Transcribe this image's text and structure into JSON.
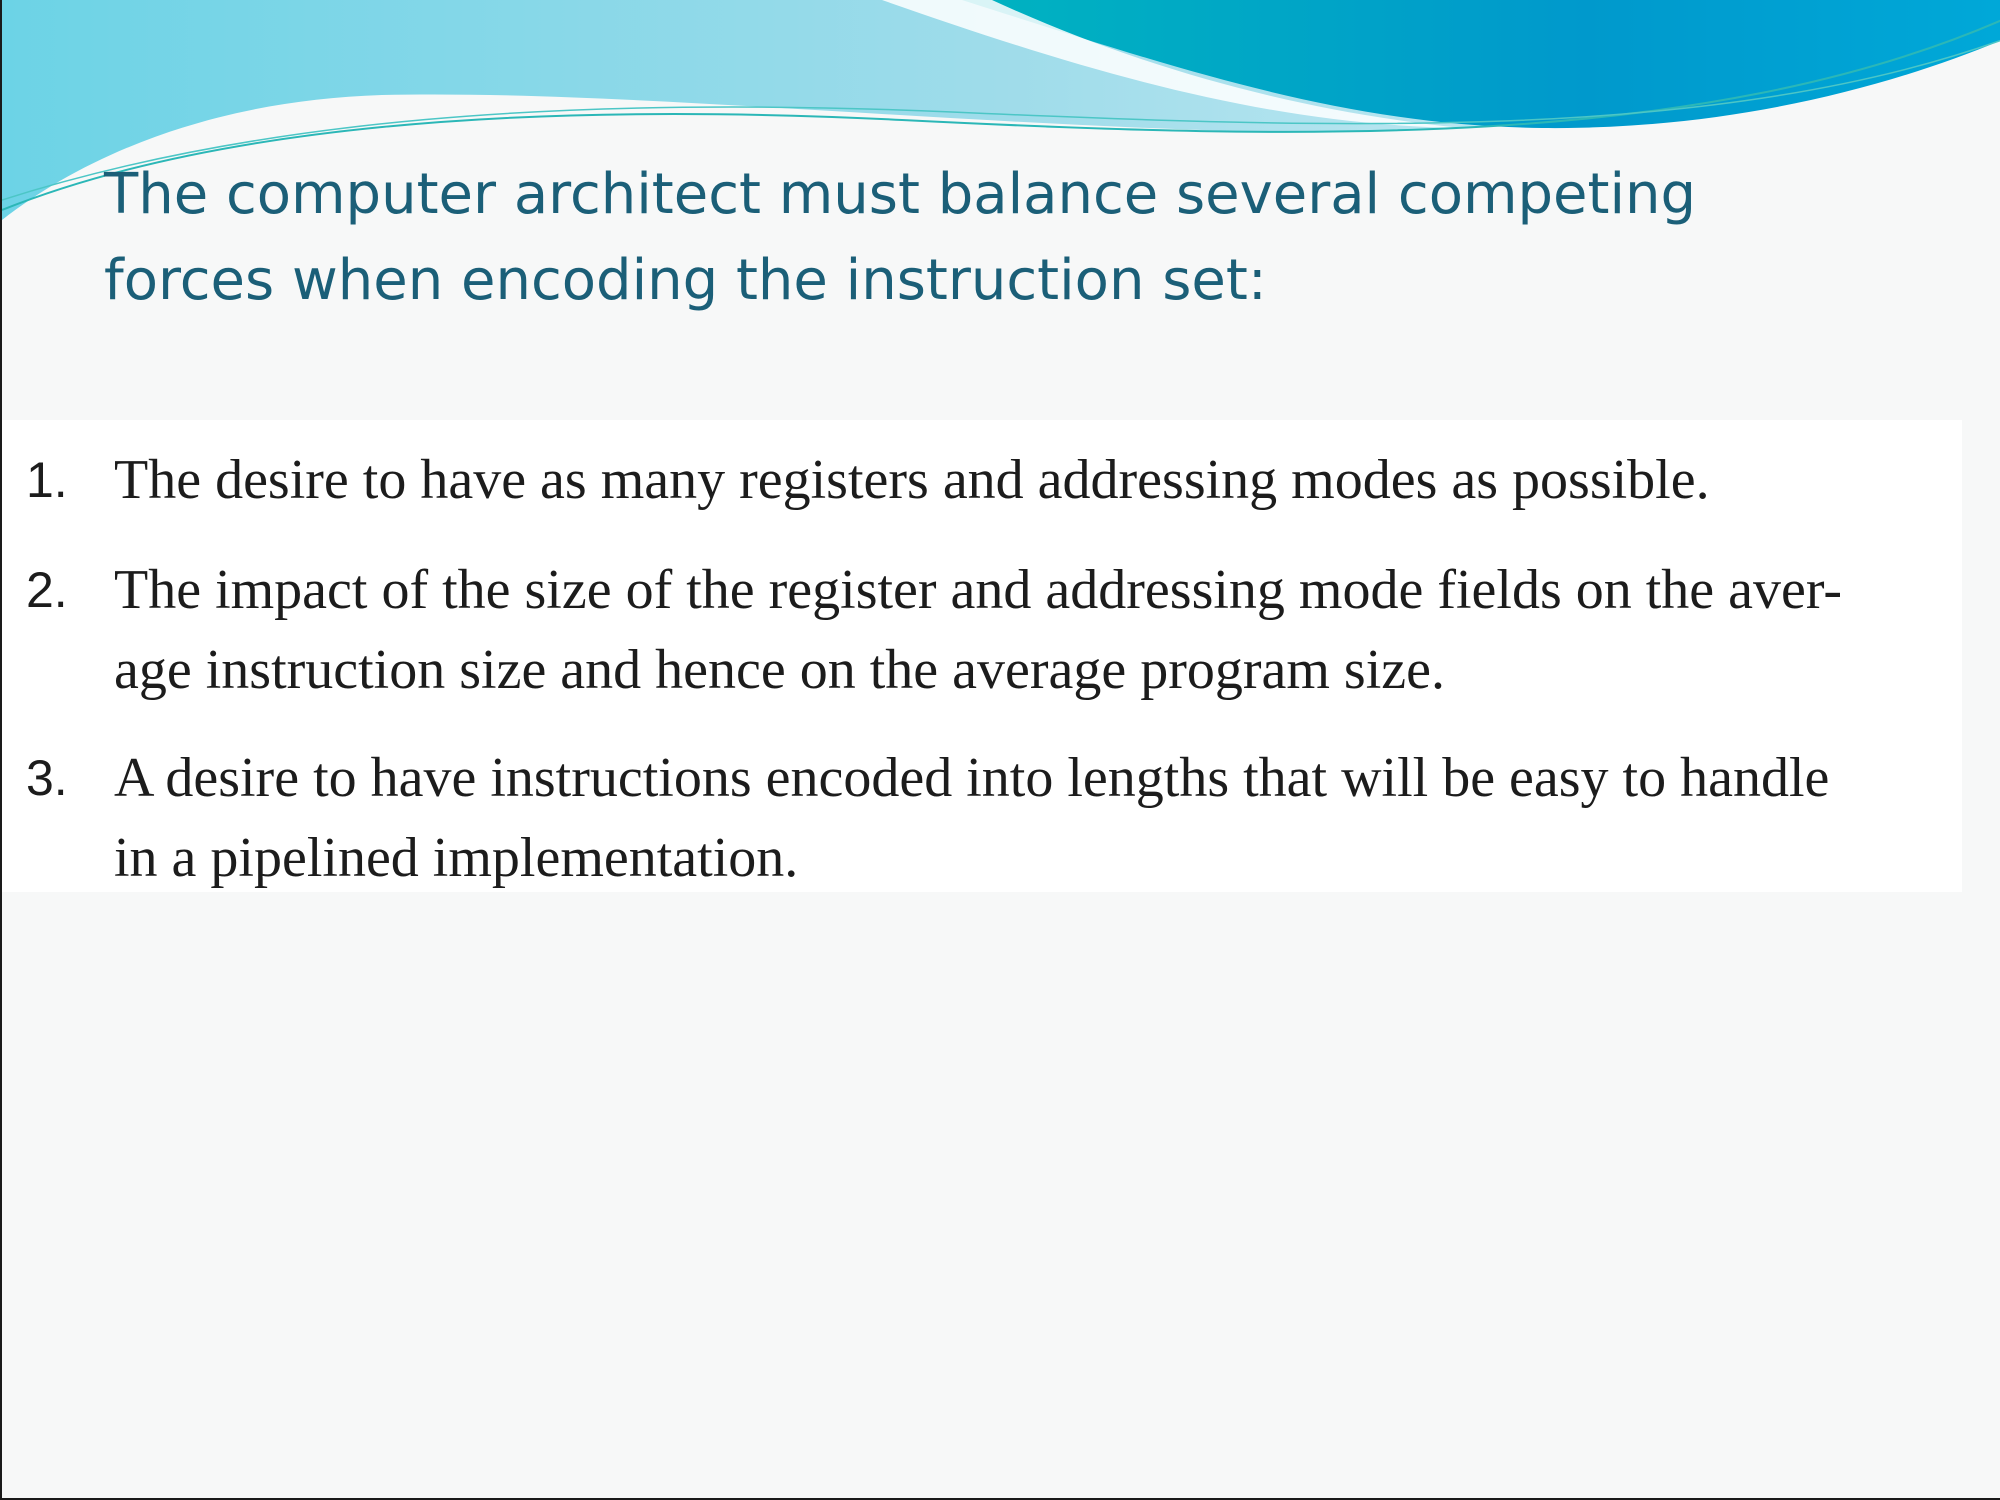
{
  "slide": {
    "title_lines": [
      "The computer architect must balance several competing",
      "forces when encoding the instruction set:"
    ],
    "items": [
      {
        "number": "1.",
        "lines": [
          "The desire to have as many registers and addressing modes as possible."
        ]
      },
      {
        "number": "2.",
        "lines": [
          "The impact of the size of the register and addressing mode fields on the aver-",
          "age instruction size and hence on the average program size."
        ]
      },
      {
        "number": "3.",
        "lines": [
          "A desire to have instructions encoded into lengths that will be easy to handle",
          "in a pipelined implementation."
        ]
      }
    ]
  },
  "colors": {
    "title": "#1b5f78",
    "banner_light": "#7fd6e8",
    "banner_dark": "#0097c4",
    "body_text": "#1c1c1c"
  }
}
